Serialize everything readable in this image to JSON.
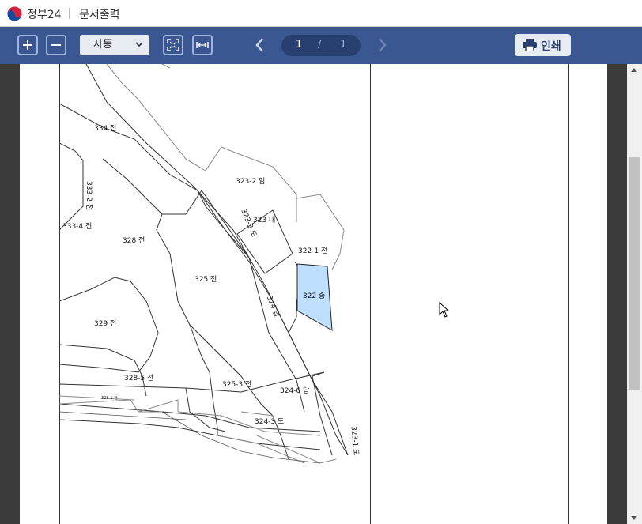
{
  "titlebar": {
    "app_name": "정부24",
    "doc_title": "문서출력"
  },
  "toolbar": {
    "zoom_value": "자동",
    "page_current": "1",
    "page_separator": "/",
    "page_total": "1",
    "print_label": "인쇄"
  },
  "icons": {
    "zoom_in": "plus-icon",
    "zoom_out": "minus-icon",
    "fit_page": "fit-page-icon",
    "fit_width": "fit-width-icon",
    "prev": "chevron-left-icon",
    "next": "chevron-right-icon",
    "print": "printer-icon"
  },
  "colors": {
    "toolbar": "#3a5791",
    "highlight_parcel": "#bfdfff",
    "pager_bg": "#27406f"
  },
  "map": {
    "labels": {
      "p334": "334 전",
      "p333_2": "333-2 전",
      "p333_4": "333-4 전",
      "p328": "328 전",
      "p323_2": "323-2 임",
      "p323": "323 대",
      "p323_3": "323-3 도",
      "p322_1": "322-1 전",
      "p322": "322 송",
      "p325": "325 전",
      "p324": "324 답",
      "p329": "329 전",
      "p328_5": "328-5 전",
      "p325_3": "325-3 전",
      "p324_6": "324-6 답",
      "p324_3": "324-3 도",
      "p328_1": "328-1 전",
      "p323_1": "323-1 도"
    }
  }
}
